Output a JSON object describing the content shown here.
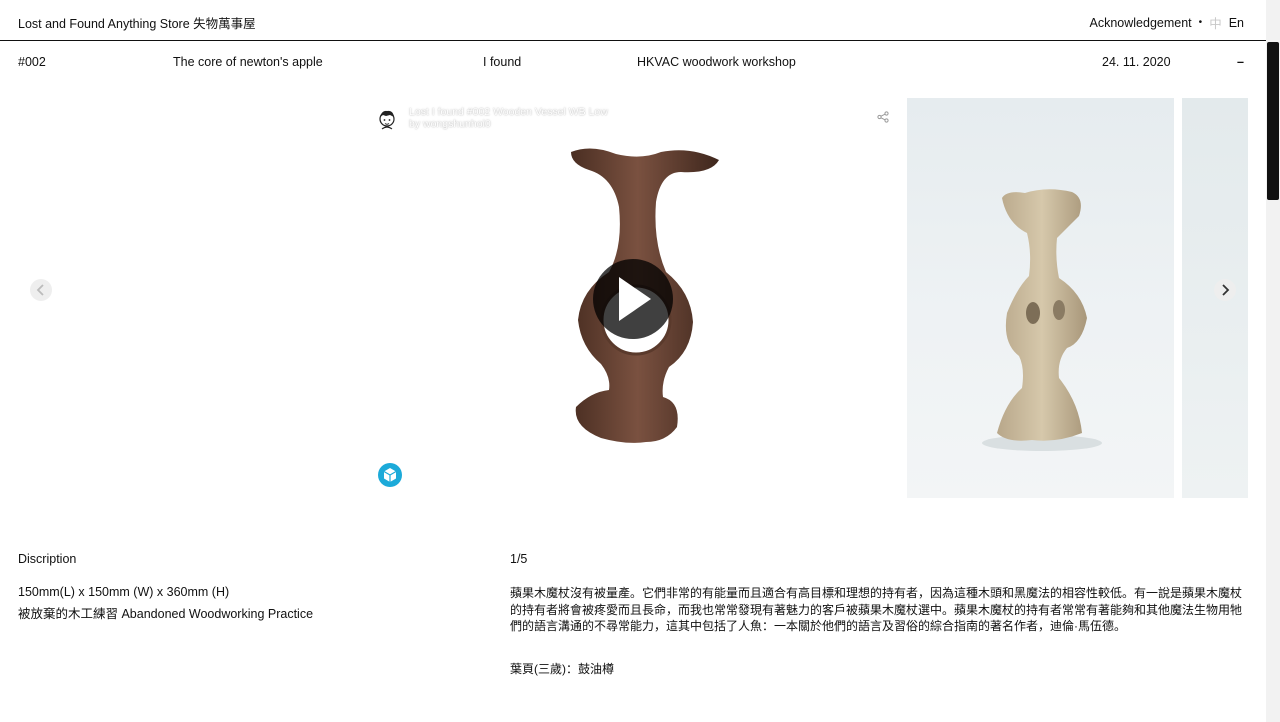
{
  "header": {
    "brand": "Lost and Found Anything Store 失物萬事屋",
    "acknowledgement": "Acknowledgement",
    "separator": "•",
    "lang_zh": "中",
    "lang_en": "En"
  },
  "item": {
    "number": "#002",
    "name": "The core of newton's apple",
    "status": "I found",
    "source": "HKVAC woodwork workshop",
    "date": "24. 11. 2020",
    "collapse_label": "–"
  },
  "viewer": {
    "model_title": "Lost I found #002 Wooden Vessel WB Low",
    "model_author": "by wongshunhoi0",
    "icons": [
      "avatar-icon",
      "share-icon",
      "play-icon",
      "sketchfab-logo-icon"
    ]
  },
  "carousel": {
    "icons": [
      "chevron-left-icon",
      "chevron-right-icon"
    ]
  },
  "details": {
    "heading": "Discription",
    "dimensions": "150mm(L) x 150mm (W) x 360mm (H)",
    "material": "被放棄的木工練習 Abandoned Woodworking Practice",
    "counter": "1/5",
    "story": "蘋果木魔杖沒有被量產。它們非常的有能量而且適合有高目標和理想的持有者，因為這種木頭和黑魔法的相容性較低。有一說是蘋果木魔杖的持有者將會被疼愛而且長命，而我也常常發現有著魅力的客戶被蘋果木魔杖選中。蘋果木魔杖的持有者常常有著能夠和其他魔法生物用牠們的語言溝通的不尋常能力，這其中包括了人魚：一本關於他們的語言及習俗的綜合指南的著名作者，迪倫·馬伍德。",
    "signature": "葉頁(三歲)：鼓油樽"
  },
  "colors": {
    "text": "#111111",
    "sketchfab": "#1caad9",
    "muted": "#c8c8c8"
  }
}
